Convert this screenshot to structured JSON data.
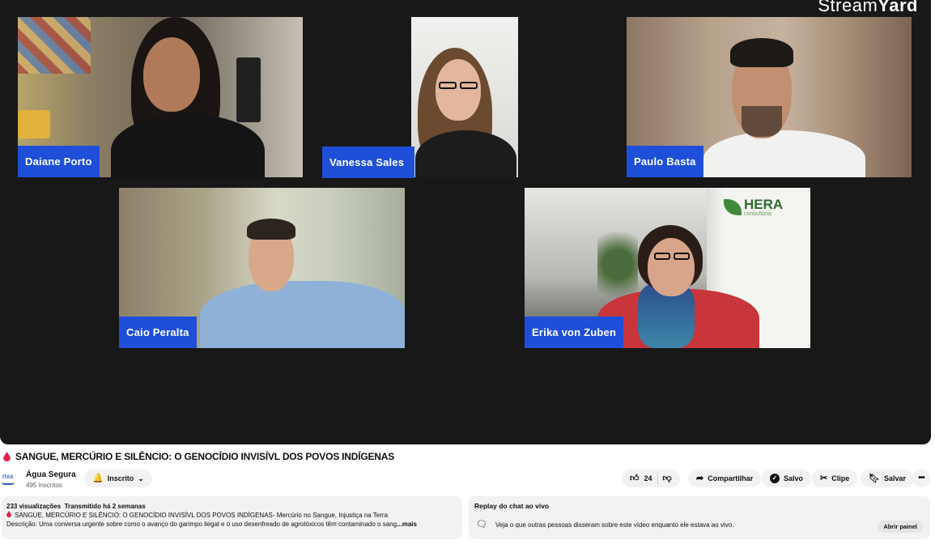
{
  "player": {
    "brand_light": "Stream",
    "brand_bold": "Yard",
    "participants": [
      {
        "name": "Daiane Porto"
      },
      {
        "name": "Vanessa Sales"
      },
      {
        "name": "Paulo Basta"
      },
      {
        "name": "Caio Peralta"
      },
      {
        "name": "Erika von Zuben"
      }
    ],
    "sponsor_logo": {
      "name": "HERA",
      "sub": "consultoria"
    }
  },
  "video": {
    "title": "SANGUE, MERCÚRIO E SILÊNCIO: O GENOCÍDIO INVISÍVL DOS POVOS INDÍGENAS"
  },
  "channel": {
    "logo_text": "ITAS",
    "name": "Água Segura",
    "subscribers": "495 inscritos",
    "subscribe_label": "Inscrito"
  },
  "actions": {
    "likes": "24",
    "share": "Compartilhar",
    "saved": "Salvo",
    "clip": "Clipe",
    "save": "Salvar"
  },
  "description": {
    "views": "233 visualizações",
    "when": "Transmitido há 2 semanas",
    "line1": "SANGUE, MERCÚRIO E SILÊNCIO: O GENOCÍDIO INVISÍVL DOS POVOS INDÍGENAS- Mercúrio no Sangue, Injustiça na Terra",
    "line2": "Descrição: Uma conversa urgente sobre como o avanço do garimpo ilegal e o uso desenfreado de agrotóxicos têm contaminado o sang",
    "more": "...mais"
  },
  "chat": {
    "title": "Replay do chat ao vivo",
    "text": "Veja o que outras pessoas disseram sobre este vídeo enquanto ele estava ao vivo.",
    "button": "Abrir painel"
  },
  "colors": {
    "name_tag": "#1f4fd8",
    "player_bg": "#181818",
    "drop": "#e0224b"
  }
}
